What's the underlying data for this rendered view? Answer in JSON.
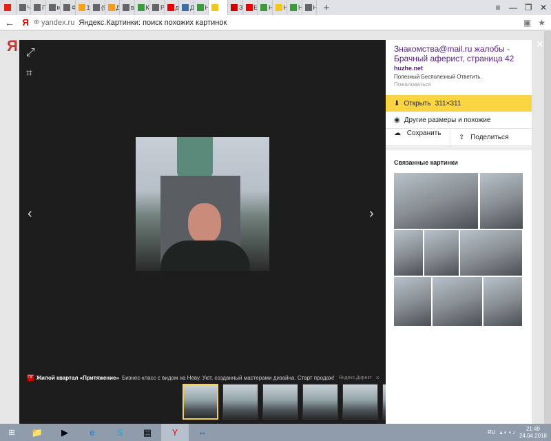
{
  "browser": {
    "tabs": [
      {
        "icon": "youtube-icon",
        "label": "",
        "color": "#e62117"
      },
      {
        "icon": "page-icon",
        "label": "Ч",
        "color": "#666"
      },
      {
        "icon": "page-icon",
        "label": "П",
        "color": "#666"
      },
      {
        "icon": "page-icon",
        "label": "м",
        "color": "#666"
      },
      {
        "icon": "page-icon",
        "label": "Ф",
        "color": "#666"
      },
      {
        "icon": "mail-icon",
        "label": "1",
        "color": "#f7a21b"
      },
      {
        "icon": "page-icon",
        "label": "(9",
        "color": "#666"
      },
      {
        "icon": "odnoklassniki-icon",
        "label": "Д",
        "color": "#f59a23"
      },
      {
        "icon": "page-icon",
        "label": "ве",
        "color": "#666"
      },
      {
        "icon": "cactus-icon",
        "label": "К",
        "color": "#3b9a3b"
      },
      {
        "icon": "page-icon",
        "label": "Р",
        "color": "#666"
      },
      {
        "icon": "yandex-icon",
        "label": "д",
        "color": "#e00"
      },
      {
        "icon": "globe-icon",
        "label": "Д",
        "color": "#3a6ea5"
      },
      {
        "icon": "cactus-icon",
        "label": "Н",
        "color": "#3b9a3b"
      },
      {
        "icon": "image-icon",
        "label": "",
        "color": "#f5c518",
        "active": true
      },
      {
        "icon": "x-icon",
        "label": "Зн",
        "color": "#c00"
      },
      {
        "icon": "yandex-icon",
        "label": "Б",
        "color": "#e00"
      },
      {
        "icon": "cactus-icon",
        "label": "Н",
        "color": "#3b9a3b"
      },
      {
        "icon": "image-icon",
        "label": "Н",
        "color": "#f5c518"
      },
      {
        "icon": "cactus-icon",
        "label": "Н",
        "color": "#3b9a3b"
      },
      {
        "icon": "page-icon",
        "label": "Н",
        "color": "#666"
      }
    ],
    "new_tab_label": "+",
    "address": {
      "domain": "yandex.ru",
      "title": "Яндекс.Картинки: поиск похожих картинок"
    },
    "window_controls": {
      "menu": "≡",
      "minimize": "—",
      "maximize": "❐",
      "close": "✕"
    }
  },
  "viewer": {
    "ad": {
      "logo": "ПГ",
      "brand": "Жилой квартал «Притяжение»",
      "text": "Бизнес-класс с видом на Неву. Уют, созданный мастерами дизайна. Старт продаж!",
      "direct": "Яндекс.Директ",
      "close": "×"
    },
    "thumbnail_count": 6
  },
  "panel": {
    "source_title": "Знакомства@mail.ru жалобы - Брачный аферист, страница 42",
    "source_domain": "huzhe.net",
    "source_meta": "Полезный Бесполезный Ответить.",
    "complain": "Пожаловаться",
    "open_label": "Открыть",
    "open_size": "311×311",
    "other_sizes_label": "Другие размеры и похожие",
    "save_label": "Сохранить",
    "share_label": "Поделиться",
    "related_title": "Связанные картинки"
  },
  "taskbar": {
    "language": "RU",
    "time": "21:49",
    "date": "24.04.2018"
  },
  "colors": {
    "accent_yellow": "#fad541",
    "link_purple": "#551a8b",
    "viewer_bg": "#1d1d1d",
    "taskbar": "#8e9cab"
  }
}
